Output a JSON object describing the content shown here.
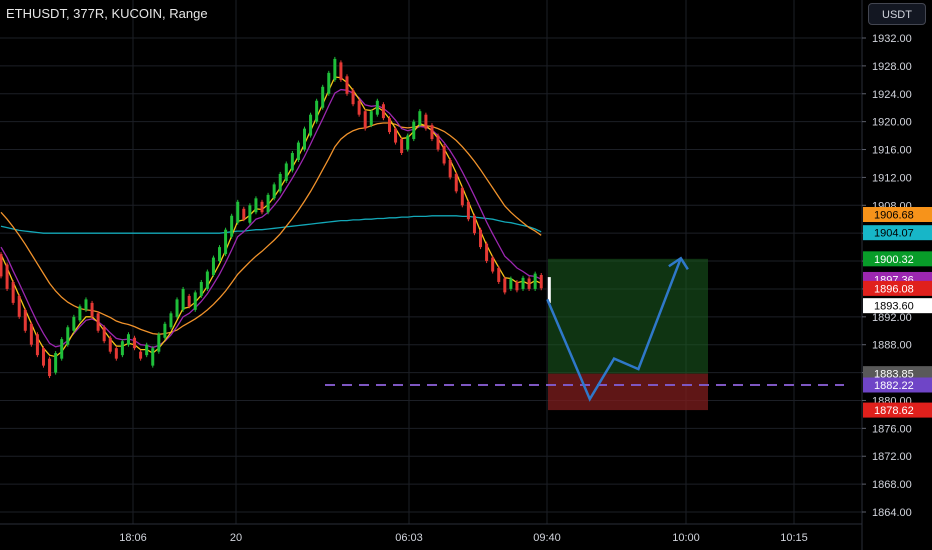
{
  "header": {
    "symbol_title": "ETHUSDT, 377R, KUCOIN, Range",
    "currency_button": "USDT"
  },
  "colors": {
    "background": "#000000",
    "grid": "#1c1f26",
    "up_candle": "#26a69a",
    "down_candle": "#ef5350",
    "ema_fast": "#f5c518",
    "ema_mid": "#9c27b0",
    "ema_slow": "#f0922b",
    "ma_long": "#13a8b8",
    "target_zone": "#1b5e20",
    "stop_zone": "#7f1d1d",
    "projection": "#2f78c9",
    "support_line": "#7e57c2"
  },
  "chart_data": {
    "type": "candlestick",
    "y_axis_label": "USDT",
    "ylim": [
      1862.0,
      1934.0
    ],
    "y_ticks": [
      "1932.00",
      "1928.00",
      "1924.00",
      "1920.00",
      "1916.00",
      "1912.00",
      "1908.00",
      "1904.00",
      "1900.00",
      "1896.00",
      "1892.00",
      "1888.00",
      "1884.00",
      "1880.00",
      "1876.00",
      "1872.00",
      "1868.00",
      "1864.00"
    ],
    "x_ticks": [
      "18:06",
      "20",
      "06:03",
      "09:40",
      "10:00",
      "10:15"
    ],
    "grid": true,
    "price_labels": [
      {
        "value": "1906.68",
        "price": 1906.68,
        "color": "#f7931a",
        "text_color": "#000000"
      },
      {
        "value": "1904.07",
        "price": 1904.07,
        "color": "#17b6c8",
        "text_color": "#000000"
      },
      {
        "value": "1900.32",
        "price": 1900.32,
        "color": "#089c29",
        "text_color": "#ffffff"
      },
      {
        "value": "1897.36",
        "price": 1897.36,
        "color": "#9c27b0",
        "text_color": "#ffffff"
      },
      {
        "value": "1896.08",
        "price": 1896.08,
        "color": "#e0201c",
        "text_color": "#ffffff"
      },
      {
        "value": "1893.60",
        "price": 1893.6,
        "color": "#ffffff",
        "text_color": "#000000"
      },
      {
        "value": "1883.85",
        "price": 1883.85,
        "color": "#595959",
        "text_color": "#ffffff"
      },
      {
        "value": "1882.22",
        "price": 1882.22,
        "color": "#6f45c7",
        "text_color": "#ffffff"
      },
      {
        "value": "1878.62",
        "price": 1878.62,
        "color": "#e0201c",
        "text_color": "#ffffff"
      }
    ],
    "candles": [
      {
        "o": 1901.0,
        "c": 1897.8
      },
      {
        "o": 1899.5,
        "c": 1896.0
      },
      {
        "o": 1897.0,
        "c": 1894.0
      },
      {
        "o": 1895.0,
        "c": 1892.0
      },
      {
        "o": 1893.0,
        "c": 1890.0
      },
      {
        "o": 1891.0,
        "c": 1888.0
      },
      {
        "o": 1889.5,
        "c": 1886.5
      },
      {
        "o": 1887.5,
        "c": 1885.0
      },
      {
        "o": 1886.0,
        "c": 1883.5
      },
      {
        "o": 1884.0,
        "c": 1886.8
      },
      {
        "o": 1886.0,
        "c": 1888.8
      },
      {
        "o": 1888.0,
        "c": 1890.5
      },
      {
        "o": 1890.0,
        "c": 1892.0
      },
      {
        "o": 1891.5,
        "c": 1893.5
      },
      {
        "o": 1893.0,
        "c": 1894.5
      },
      {
        "o": 1894.0,
        "c": 1892.0
      },
      {
        "o": 1892.5,
        "c": 1890.0
      },
      {
        "o": 1890.5,
        "c": 1888.5
      },
      {
        "o": 1889.0,
        "c": 1887.0
      },
      {
        "o": 1887.5,
        "c": 1886.0
      },
      {
        "o": 1886.5,
        "c": 1888.5
      },
      {
        "o": 1888.0,
        "c": 1889.5
      },
      {
        "o": 1889.0,
        "c": 1887.5
      },
      {
        "o": 1887.0,
        "c": 1886.0
      },
      {
        "o": 1886.5,
        "c": 1888.0
      },
      {
        "o": 1885.0,
        "c": 1887.5
      },
      {
        "o": 1887.0,
        "c": 1889.5
      },
      {
        "o": 1889.0,
        "c": 1891.0
      },
      {
        "o": 1890.5,
        "c": 1892.5
      },
      {
        "o": 1892.0,
        "c": 1894.5
      },
      {
        "o": 1893.0,
        "c": 1896.0
      },
      {
        "o": 1895.0,
        "c": 1893.5
      },
      {
        "o": 1893.0,
        "c": 1895.5
      },
      {
        "o": 1895.0,
        "c": 1897.0
      },
      {
        "o": 1896.0,
        "c": 1898.5
      },
      {
        "o": 1898.0,
        "c": 1900.5
      },
      {
        "o": 1900.0,
        "c": 1902.0
      },
      {
        "o": 1901.0,
        "c": 1904.5
      },
      {
        "o": 1903.5,
        "c": 1906.5
      },
      {
        "o": 1905.5,
        "c": 1908.5
      },
      {
        "o": 1907.5,
        "c": 1906.0
      },
      {
        "o": 1905.5,
        "c": 1908.0
      },
      {
        "o": 1907.0,
        "c": 1909.0
      },
      {
        "o": 1908.5,
        "c": 1907.0
      },
      {
        "o": 1907.0,
        "c": 1909.5
      },
      {
        "o": 1909.0,
        "c": 1911.0
      },
      {
        "o": 1910.0,
        "c": 1912.5
      },
      {
        "o": 1911.5,
        "c": 1914.0
      },
      {
        "o": 1913.0,
        "c": 1915.5
      },
      {
        "o": 1914.5,
        "c": 1917.0
      },
      {
        "o": 1916.0,
        "c": 1919.0
      },
      {
        "o": 1918.0,
        "c": 1921.0
      },
      {
        "o": 1920.0,
        "c": 1923.0
      },
      {
        "o": 1922.0,
        "c": 1925.0
      },
      {
        "o": 1924.0,
        "c": 1927.0
      },
      {
        "o": 1926.0,
        "c": 1929.0
      },
      {
        "o": 1928.5,
        "c": 1926.0
      },
      {
        "o": 1926.5,
        "c": 1924.0
      },
      {
        "o": 1924.5,
        "c": 1922.5
      },
      {
        "o": 1923.0,
        "c": 1921.0
      },
      {
        "o": 1921.5,
        "c": 1919.0
      },
      {
        "o": 1919.5,
        "c": 1921.5
      },
      {
        "o": 1921.0,
        "c": 1923.0
      },
      {
        "o": 1922.5,
        "c": 1920.5
      },
      {
        "o": 1920.5,
        "c": 1918.5
      },
      {
        "o": 1919.0,
        "c": 1917.0
      },
      {
        "o": 1917.5,
        "c": 1915.5
      },
      {
        "o": 1916.0,
        "c": 1918.0
      },
      {
        "o": 1917.5,
        "c": 1920.0
      },
      {
        "o": 1919.5,
        "c": 1921.5
      },
      {
        "o": 1921.0,
        "c": 1919.0
      },
      {
        "o": 1919.5,
        "c": 1917.5
      },
      {
        "o": 1918.0,
        "c": 1916.0
      },
      {
        "o": 1916.5,
        "c": 1914.0
      },
      {
        "o": 1914.5,
        "c": 1912.0
      },
      {
        "o": 1912.5,
        "c": 1910.0
      },
      {
        "o": 1910.5,
        "c": 1908.0
      },
      {
        "o": 1908.5,
        "c": 1906.0
      },
      {
        "o": 1906.5,
        "c": 1904.0
      },
      {
        "o": 1904.5,
        "c": 1902.0
      },
      {
        "o": 1902.5,
        "c": 1900.0
      },
      {
        "o": 1900.5,
        "c": 1898.5
      },
      {
        "o": 1899.0,
        "c": 1897.0
      },
      {
        "o": 1897.5,
        "c": 1895.5
      },
      {
        "o": 1896.0,
        "c": 1897.5
      },
      {
        "o": 1897.0,
        "c": 1895.8
      },
      {
        "o": 1896.0,
        "c": 1897.6
      },
      {
        "o": 1897.5,
        "c": 1896.0
      },
      {
        "o": 1896.0,
        "c": 1898.2
      },
      {
        "o": 1898.0,
        "c": 1896.1
      }
    ],
    "ema_fast": [
      1901,
      1899,
      1897,
      1895,
      1893,
      1891,
      1889,
      1887.5,
      1886.5,
      1886.3,
      1887,
      1888.3,
      1889.8,
      1891,
      1892,
      1892,
      1891.2,
      1890,
      1888.8,
      1887.8,
      1887.8,
      1888.2,
      1888,
      1887.3,
      1887.3,
      1886.8,
      1887.5,
      1888.6,
      1889.8,
      1891.5,
      1893.2,
      1893.4,
      1894.1,
      1895.1,
      1896.4,
      1898,
      1899.6,
      1901.5,
      1903.6,
      1905.7,
      1905.9,
      1906.6,
      1907.5,
      1907.4,
      1908.1,
      1909.2,
      1910.5,
      1912,
      1913.5,
      1915,
      1916.8,
      1918.7,
      1920.6,
      1922.5,
      1924.5,
      1926.4,
      1926.3,
      1925.6,
      1924.5,
      1923.2,
      1921.7,
      1921.6,
      1922.1,
      1921.5,
      1920.4,
      1919,
      1917.6,
      1917.7,
      1918.6,
      1919.7,
      1919.4,
      1918.7,
      1917.6,
      1916.1,
      1914.5,
      1912.6,
      1910.6,
      1908.5,
      1906.4,
      1904.3,
      1902.3,
      1900.6,
      1899.1,
      1897.6,
      1897.5,
      1896.9,
      1897.1,
      1896.7,
      1897.2,
      1896.8
    ],
    "ema_mid": [
      1902,
      1900.5,
      1898.6,
      1896.8,
      1894.9,
      1893,
      1891.2,
      1889.6,
      1888.2,
      1887.7,
      1887.9,
      1888.6,
      1889.6,
      1890.6,
      1891.5,
      1891.7,
      1891.3,
      1890.6,
      1889.7,
      1888.9,
      1888.7,
      1888.8,
      1888.6,
      1888,
      1887.9,
      1887.6,
      1887.9,
      1888.5,
      1889.4,
      1890.6,
      1892,
      1892.5,
      1893.3,
      1894.2,
      1895.3,
      1896.7,
      1898.1,
      1899.8,
      1901.6,
      1903.5,
      1904.2,
      1905.1,
      1906,
      1906.3,
      1907,
      1908,
      1909.1,
      1910.5,
      1911.9,
      1913.4,
      1915,
      1916.8,
      1918.6,
      1920.4,
      1922.3,
      1924.1,
      1924.6,
      1924.5,
      1924.1,
      1923.4,
      1922.4,
      1922.2,
      1922.3,
      1921.9,
      1921.2,
      1920.2,
      1919,
      1918.7,
      1918.9,
      1919.3,
      1919.2,
      1918.8,
      1918,
      1917,
      1915.8,
      1914.4,
      1912.8,
      1911.1,
      1909.3,
      1907.5,
      1905.6,
      1903.9,
      1902.3,
      1900.7,
      1899.9,
      1899,
      1898.5,
      1897.9,
      1897.8,
      1897.4
    ],
    "ema_slow": [
      1907,
      1906,
      1904.9,
      1903.7,
      1902.4,
      1901,
      1899.6,
      1898.2,
      1896.8,
      1895.7,
      1894.8,
      1894.1,
      1893.6,
      1893.2,
      1893,
      1892.9,
      1892.7,
      1892.3,
      1891.9,
      1891.4,
      1891.1,
      1890.9,
      1890.6,
      1890.2,
      1889.9,
      1889.6,
      1889.5,
      1889.6,
      1889.8,
      1890.1,
      1890.7,
      1891.2,
      1891.7,
      1892.3,
      1893,
      1893.8,
      1894.7,
      1895.7,
      1896.9,
      1898.1,
      1899,
      1899.9,
      1900.7,
      1901.4,
      1902.2,
      1903,
      1903.9,
      1905,
      1906.1,
      1907.3,
      1908.6,
      1910,
      1911.5,
      1913.1,
      1914.7,
      1916.4,
      1917.5,
      1918.2,
      1918.7,
      1919,
      1919.1,
      1919.4,
      1919.7,
      1919.8,
      1919.8,
      1919.6,
      1919.2,
      1919.1,
      1919.2,
      1919.4,
      1919.4,
      1919.3,
      1919,
      1918.6,
      1918,
      1917.3,
      1916.4,
      1915.4,
      1914.3,
      1913.1,
      1911.8,
      1910.5,
      1909.2,
      1907.9,
      1907,
      1906.2,
      1905.5,
      1904.8,
      1904.3,
      1903.7
    ],
    "ma_long": [
      1905,
      1904.8,
      1904.6,
      1904.4,
      1904.3,
      1904.2,
      1904.1,
      1904,
      1904,
      1904,
      1904,
      1904,
      1904,
      1904,
      1904,
      1904,
      1904,
      1904,
      1904,
      1904,
      1904,
      1904,
      1904,
      1904,
      1904,
      1904,
      1904,
      1904,
      1904,
      1904,
      1904,
      1904,
      1904,
      1904,
      1904,
      1904,
      1904,
      1904.1,
      1904.2,
      1904.3,
      1904.3,
      1904.4,
      1904.5,
      1904.5,
      1904.6,
      1904.7,
      1904.8,
      1904.9,
      1905,
      1905.1,
      1905.2,
      1905.3,
      1905.4,
      1905.5,
      1905.6,
      1905.7,
      1905.8,
      1905.8,
      1905.9,
      1905.9,
      1906,
      1906,
      1906.1,
      1906.1,
      1906.2,
      1906.2,
      1906.3,
      1906.3,
      1906.4,
      1906.4,
      1906.4,
      1906.5,
      1906.5,
      1906.5,
      1906.5,
      1906.5,
      1906.4,
      1906.4,
      1906.3,
      1906.2,
      1906.1,
      1906,
      1905.8,
      1905.6,
      1905.5,
      1905.3,
      1905.1,
      1904.9,
      1904.6,
      1904.2
    ],
    "trade_setup": {
      "entry": 1883.85,
      "target": 1900.32,
      "stop": 1878.62,
      "support_level": 1882.22
    },
    "projection_path": [
      {
        "bar": 90,
        "price": 1894.5
      },
      {
        "bar": 97,
        "price": 1880.2
      },
      {
        "bar": 101,
        "price": 1886.0
      },
      {
        "bar": 105,
        "price": 1884.5
      },
      {
        "bar": 112,
        "price": 1900.4
      }
    ]
  }
}
